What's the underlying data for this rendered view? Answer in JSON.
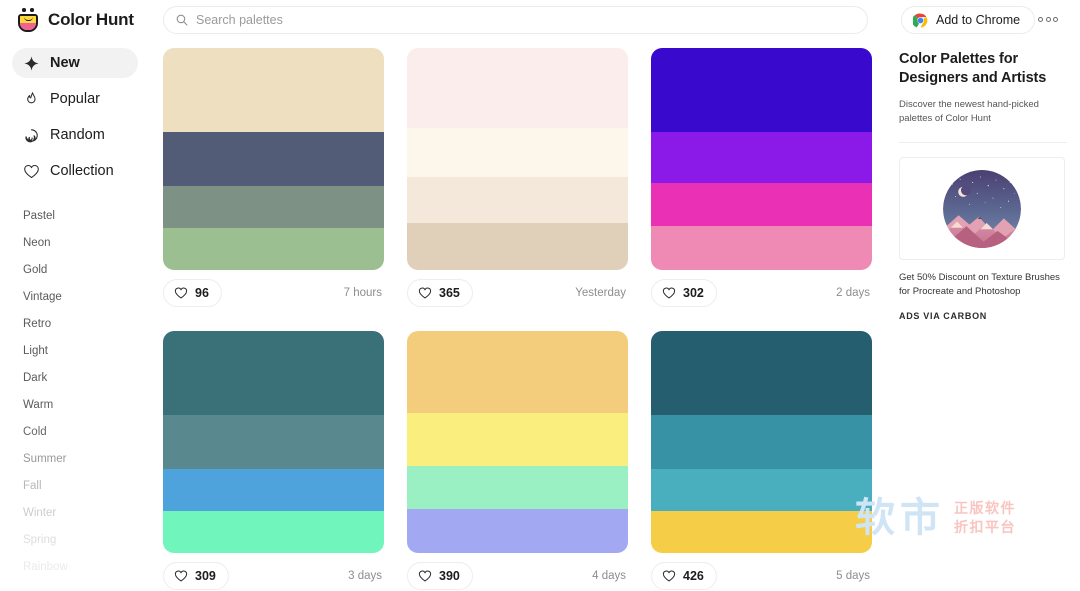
{
  "brand": {
    "name": "Color Hunt",
    "logo_icon": "color-hunt-cup-logo"
  },
  "search": {
    "placeholder": "Search palettes",
    "value": "",
    "icon": "search-icon"
  },
  "header": {
    "chrome_button_label": "Add to Chrome",
    "chrome_icon": "chrome-logo-icon",
    "more_icon": "three-dots-icon"
  },
  "sidebar": {
    "nav": [
      {
        "label": "New",
        "icon": "sparkle-star-icon",
        "active": true
      },
      {
        "label": "Popular",
        "icon": "flame-icon",
        "active": false
      },
      {
        "label": "Random",
        "icon": "spiral-icon",
        "active": false
      },
      {
        "label": "Collection",
        "icon": "heart-icon",
        "active": false
      }
    ],
    "tags": [
      {
        "label": "Pastel",
        "opacity": 1
      },
      {
        "label": "Neon",
        "opacity": 1
      },
      {
        "label": "Gold",
        "opacity": 1
      },
      {
        "label": "Vintage",
        "opacity": 1
      },
      {
        "label": "Retro",
        "opacity": 1
      },
      {
        "label": "Light",
        "opacity": 1
      },
      {
        "label": "Dark",
        "opacity": 1
      },
      {
        "label": "Warm",
        "opacity": 1
      },
      {
        "label": "Cold",
        "opacity": 0.92
      },
      {
        "label": "Summer",
        "opacity": 0.62
      },
      {
        "label": "Fall",
        "opacity": 0.44
      },
      {
        "label": "Winter",
        "opacity": 0.3
      },
      {
        "label": "Spring",
        "opacity": 0.2
      },
      {
        "label": "Rainbow",
        "opacity": 0.12
      }
    ]
  },
  "palettes": [
    {
      "colors": [
        "#EEDFC0",
        "#535C77",
        "#7D9284",
        "#9BBF90"
      ],
      "heights": [
        38,
        24,
        19,
        19
      ],
      "likes": "96",
      "time": "7 hours"
    },
    {
      "colors": [
        "#FBEDEC",
        "#FDF6EA",
        "#F3E8DA",
        "#E0D0BA"
      ],
      "heights": [
        36,
        22,
        21,
        21
      ],
      "likes": "365",
      "time": "Yesterday"
    },
    {
      "colors": [
        "#3A09CE",
        "#8B1AE8",
        "#EA31B6",
        "#EE8AB3"
      ],
      "heights": [
        38,
        23,
        19,
        20
      ],
      "likes": "302",
      "time": "2 days"
    },
    {
      "colors": [
        "#3A7078",
        "#59898F",
        "#4FA3DC",
        "#70F5BC"
      ],
      "heights": [
        38,
        24,
        19,
        19
      ],
      "likes": "309",
      "time": "3 days"
    },
    {
      "colors": [
        "#F3CD7B",
        "#FAEE7F",
        "#9BF0C3",
        "#A3A8F2"
      ],
      "heights": [
        37,
        24,
        19,
        20
      ],
      "likes": "390",
      "time": "4 days"
    },
    {
      "colors": [
        "#255E6E",
        "#3692A4",
        "#49AFBF",
        "#F5CD46"
      ],
      "heights": [
        38,
        24,
        19,
        19
      ],
      "likes": "426",
      "time": "5 days"
    }
  ],
  "right_panel": {
    "title": "Color Palettes for Designers and Artists",
    "subtitle": "Discover the newest hand-picked palettes of Color Hunt",
    "ad_image": "night-mountains-illustration",
    "ad_text": "Get 50% Discount on Texture Brushes for Procreate and Photoshop",
    "ad_via": "ADS VIA CARBON"
  },
  "watermark": {
    "main": "软市",
    "line1": "正版软件",
    "line2": "折扣平台"
  },
  "colors": {
    "page_bg": "#ffffff",
    "active_nav_bg": "#f2f2f2",
    "border": "#ebebeb",
    "text": "#1c1c1c",
    "muted_text": "#8d8d8d",
    "watermark_blue": "#cfe4f5",
    "watermark_pink": "#f9c5c0"
  }
}
